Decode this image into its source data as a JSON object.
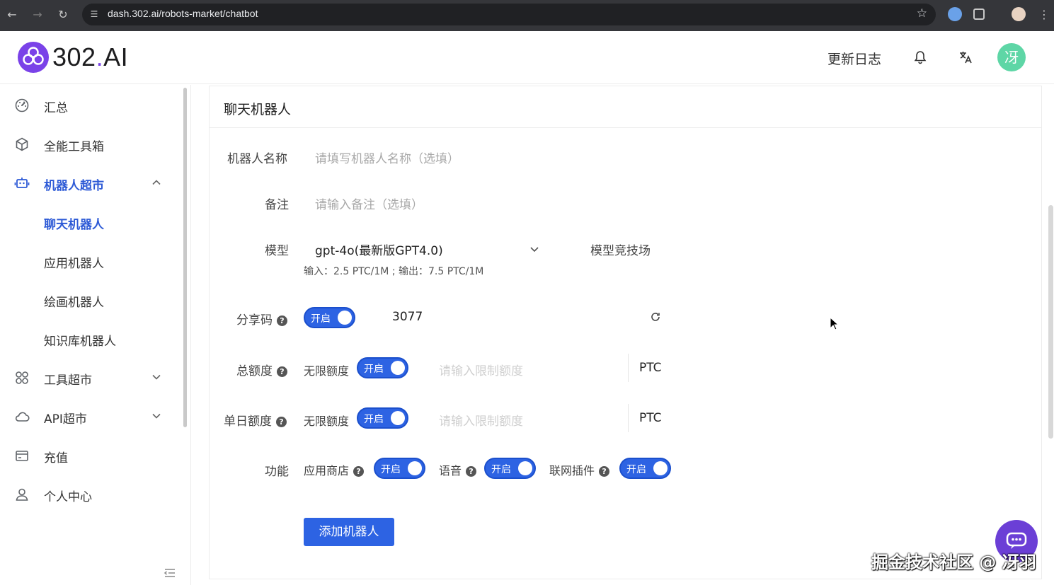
{
  "browser": {
    "url": "dash.302.ai/robots-market/chatbot"
  },
  "header": {
    "logo_main": "302",
    "logo_dot": ".",
    "logo_suffix": "AI",
    "changelog": "更新日志",
    "avatar_text": "冴"
  },
  "sidebar": {
    "items": [
      {
        "label": "汇总",
        "icon": "dashboard-icon"
      },
      {
        "label": "全能工具箱",
        "icon": "cube-icon"
      },
      {
        "label": "机器人超市",
        "icon": "robot-icon",
        "expanded": true,
        "active": true
      },
      {
        "label": "工具超市",
        "icon": "grid-icon"
      },
      {
        "label": "API超市",
        "icon": "cloud-api-icon"
      },
      {
        "label": "充值",
        "icon": "wallet-icon"
      },
      {
        "label": "个人中心",
        "icon": "user-icon"
      }
    ],
    "subitems": [
      {
        "label": "聊天机器人",
        "active": true
      },
      {
        "label": "应用机器人"
      },
      {
        "label": "绘画机器人"
      },
      {
        "label": "知识库机器人"
      }
    ]
  },
  "form": {
    "title": "聊天机器人",
    "name_label": "机器人名称",
    "name_placeholder": "请填写机器人名称（选填）",
    "note_label": "备注",
    "note_placeholder": "请输入备注（选填）",
    "model_label": "模型",
    "model_value": "gpt-4o(最新版GPT4.0)",
    "model_arena": "模型竞技场",
    "model_price": "输入：2.5 PTC/1M ; 输出：7.5 PTC/1M",
    "share_label": "分享码",
    "share_toggle": "开启",
    "share_code": "3077",
    "total_label": "总额度",
    "unlimited": "无限额度",
    "unlimited_toggle": "开启",
    "limit_placeholder": "请输入限制额度",
    "unit": "PTC",
    "daily_label": "单日额度",
    "feature_label": "功能",
    "feat_store": "应用商店",
    "feat_voice": "语音",
    "feat_web": "联网插件",
    "toggle_on": "开启",
    "add_button": "添加机器人"
  },
  "watermark": "掘金技术社区 @ 冴羽",
  "colors": {
    "accent": "#2d63e3",
    "brand": "#7a42e8",
    "avatar": "#5ed6a6"
  }
}
